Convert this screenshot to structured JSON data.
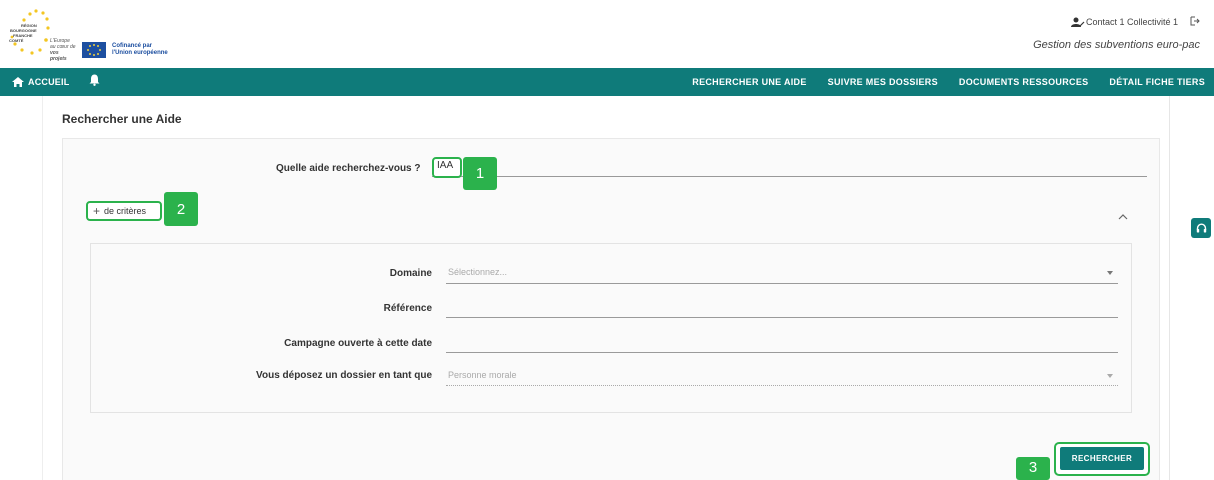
{
  "header": {
    "region_logo_lines": [
      "RÉGION",
      "BOURGOGNE",
      "FRANCHE",
      "COMTÉ"
    ],
    "eu_small_text": [
      "L'Europe",
      "au cœur de",
      "vos projets"
    ],
    "eu_cofinance": [
      "Cofinancé par",
      "l'Union européenne"
    ],
    "user_name": "Contact 1 Collectivité 1",
    "app_name": "Gestion des subventions euro-pac"
  },
  "nav": {
    "home_label": "ACCUEIL",
    "items": [
      "RECHERCHER UNE AIDE",
      "SUIVRE MES DOSSIERS",
      "DOCUMENTS RESSOURCES",
      "DÉTAIL FICHE TIERS"
    ]
  },
  "page": {
    "title": "Rechercher une Aide"
  },
  "search": {
    "question_label": "Quelle aide recherchez-vous ?",
    "query_value": "IAA",
    "criteria_label": "de critères",
    "criteria_plus": "+"
  },
  "criteria": {
    "domaine_label": "Domaine",
    "domaine_placeholder": "Sélectionnez...",
    "reference_label": "Référence",
    "campagne_label": "Campagne ouverte à cette date",
    "deposez_label": "Vous déposez un dossier en tant que",
    "deposez_value": "Personne morale"
  },
  "actions": {
    "search_label": "RECHERCHER"
  },
  "annotations": [
    "1",
    "2",
    "3"
  ],
  "colors": {
    "brand_teal": "#0f7b7a",
    "annotation_green": "#2bb24c"
  }
}
